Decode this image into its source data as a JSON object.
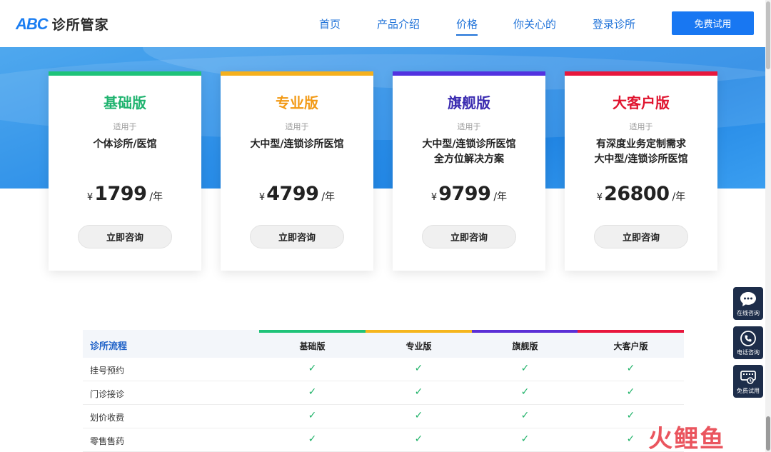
{
  "header": {
    "logo_abc": "ABC",
    "logo_name": "诊所管家",
    "nav": [
      {
        "label": "首页"
      },
      {
        "label": "产品介绍"
      },
      {
        "label": "价格"
      },
      {
        "label": "你关心的"
      },
      {
        "label": "登录诊所"
      }
    ],
    "trial_button": "免费试用"
  },
  "plans": [
    {
      "title": "基础版",
      "color": "#1fc379",
      "for_label": "适用于",
      "target": "个体诊所/医馆",
      "currency": "¥",
      "price": "1799",
      "unit": "/年",
      "button": "立即咨询"
    },
    {
      "title": "专业版",
      "color": "#f5a623",
      "for_label": "适用于",
      "target": "大中型/连锁诊所医馆",
      "currency": "¥",
      "price": "4799",
      "unit": "/年",
      "button": "立即咨询"
    },
    {
      "title": "旗舰版",
      "color": "#4b2fd6",
      "for_label": "适用于",
      "target": "大中型/连锁诊所医馆\n全方位解决方案",
      "currency": "¥",
      "price": "9799",
      "unit": "/年",
      "button": "立即咨询"
    },
    {
      "title": "大客户版",
      "color": "#e8173d",
      "for_label": "适用于",
      "target": "有深度业务定制需求\n大中型/连锁诊所医馆",
      "currency": "¥",
      "price": "26800",
      "unit": "/年",
      "button": "立即咨询"
    }
  ],
  "comparison": {
    "section_title": "诊所流程",
    "columns": [
      "基础版",
      "专业版",
      "旗舰版",
      "大客户版"
    ],
    "column_colors": [
      "#1fc379",
      "#f5b61d",
      "#5a2fd6",
      "#e8173d"
    ],
    "check_mark": "✓",
    "rows": [
      {
        "label": "挂号预约",
        "values": [
          true,
          true,
          true,
          true
        ]
      },
      {
        "label": "门诊接诊",
        "values": [
          true,
          true,
          true,
          true
        ]
      },
      {
        "label": "划价收费",
        "values": [
          true,
          true,
          true,
          true
        ]
      },
      {
        "label": "零售售药",
        "values": [
          true,
          true,
          true,
          true
        ]
      }
    ]
  },
  "floating": [
    {
      "label": "在线咨询",
      "icon": "chat-icon"
    },
    {
      "label": "电话咨询",
      "icon": "phone-icon"
    },
    {
      "label": "免费试用",
      "icon": "trial-icon"
    }
  ],
  "watermark": "火鲤鱼"
}
